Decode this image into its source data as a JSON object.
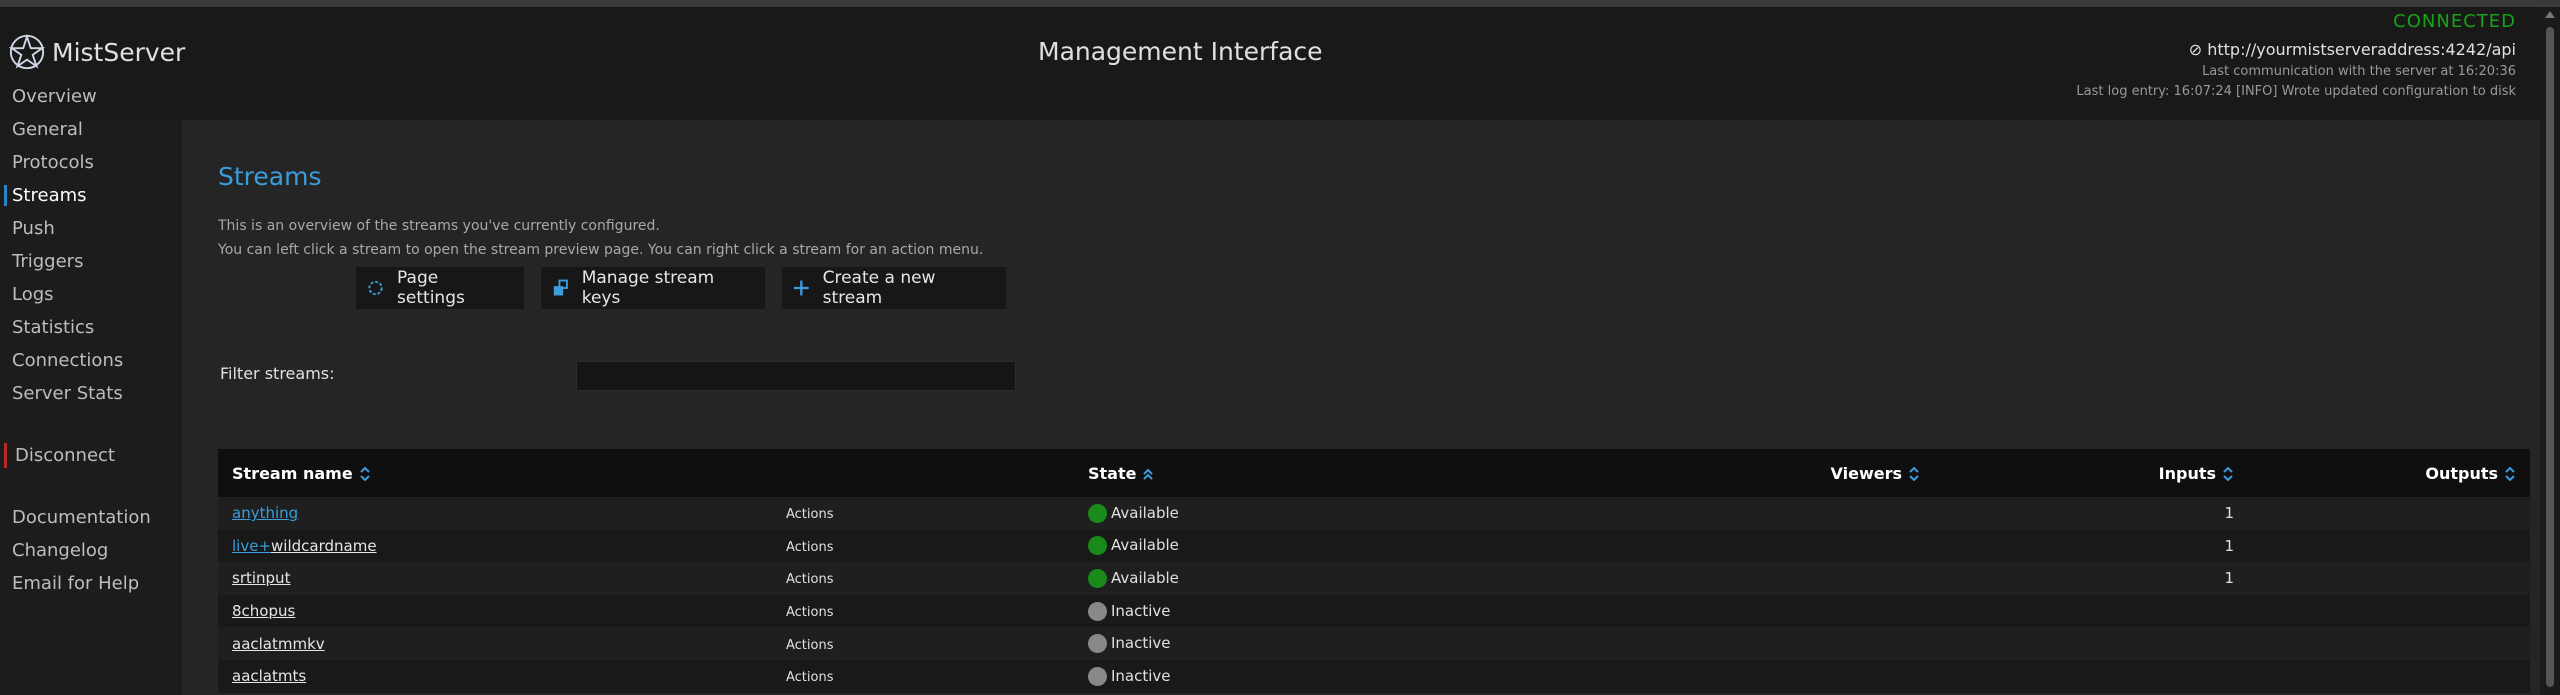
{
  "app": {
    "name": "MistServer",
    "title": "Management Interface"
  },
  "connection": {
    "status": "CONNECTED",
    "host": "http://yourmistserveraddress:4242/api",
    "last_comm": "Last communication with the server at 16:20:36",
    "last_log": "Last log entry: 16:07:24 [INFO] Wrote updated configuration to disk"
  },
  "nav": {
    "items": [
      {
        "label": "Overview"
      },
      {
        "label": "General"
      },
      {
        "label": "Protocols"
      },
      {
        "label": "Streams",
        "active": true
      },
      {
        "label": "Push"
      },
      {
        "label": "Triggers"
      },
      {
        "label": "Logs"
      },
      {
        "label": "Statistics"
      },
      {
        "label": "Connections"
      },
      {
        "label": "Server Stats"
      }
    ],
    "disconnect": "Disconnect",
    "links": [
      {
        "label": "Documentation"
      },
      {
        "label": "Changelog"
      },
      {
        "label": "Email for Help"
      }
    ]
  },
  "page": {
    "title": "Streams",
    "desc1": "This is an overview of the streams you've currently configured.",
    "desc2": "You can left click a stream to open the stream preview page. You can right click a stream for an action menu."
  },
  "buttons": {
    "page_settings": "Page settings",
    "manage_keys": "Manage stream keys",
    "create": "Create a new stream"
  },
  "filter": {
    "label": "Filter streams:",
    "value": ""
  },
  "table": {
    "headers": {
      "name": "Stream name",
      "state": "State",
      "viewers": "Viewers",
      "inputs": "Inputs",
      "outputs": "Outputs"
    },
    "rows": [
      {
        "name": "anything",
        "prefix": "",
        "action": "Actions",
        "state": "Available",
        "active": true,
        "viewers": "",
        "inputs": "1",
        "outputs": ""
      },
      {
        "name": "wildcardname",
        "prefix": "live+",
        "action": "Actions",
        "state": "Available",
        "active": true,
        "viewers": "",
        "inputs": "1",
        "outputs": ""
      },
      {
        "name": "srtinput",
        "prefix": "",
        "action": "Actions",
        "state": "Available",
        "active": true,
        "viewers": "",
        "inputs": "1",
        "outputs": ""
      },
      {
        "name": "8chopus",
        "prefix": "",
        "action": "Actions",
        "state": "Inactive",
        "active": false,
        "viewers": "",
        "inputs": "",
        "outputs": ""
      },
      {
        "name": "aaclatmmkv",
        "prefix": "",
        "action": "Actions",
        "state": "Inactive",
        "active": false,
        "viewers": "",
        "inputs": "",
        "outputs": ""
      },
      {
        "name": "aaclatmts",
        "prefix": "",
        "action": "Actions",
        "state": "Inactive",
        "active": false,
        "viewers": "",
        "inputs": "",
        "outputs": ""
      }
    ]
  },
  "colors": {
    "accent": "#3b9ddb",
    "connected": "#17a317",
    "available": "#1a8a1a",
    "inactive": "#888888"
  },
  "icons": {
    "logo": "mistserver-star-logo",
    "page_settings": "gear-icon",
    "manage_keys": "key-icon",
    "create": "plus-icon",
    "sort": "sort-arrows-icon"
  }
}
